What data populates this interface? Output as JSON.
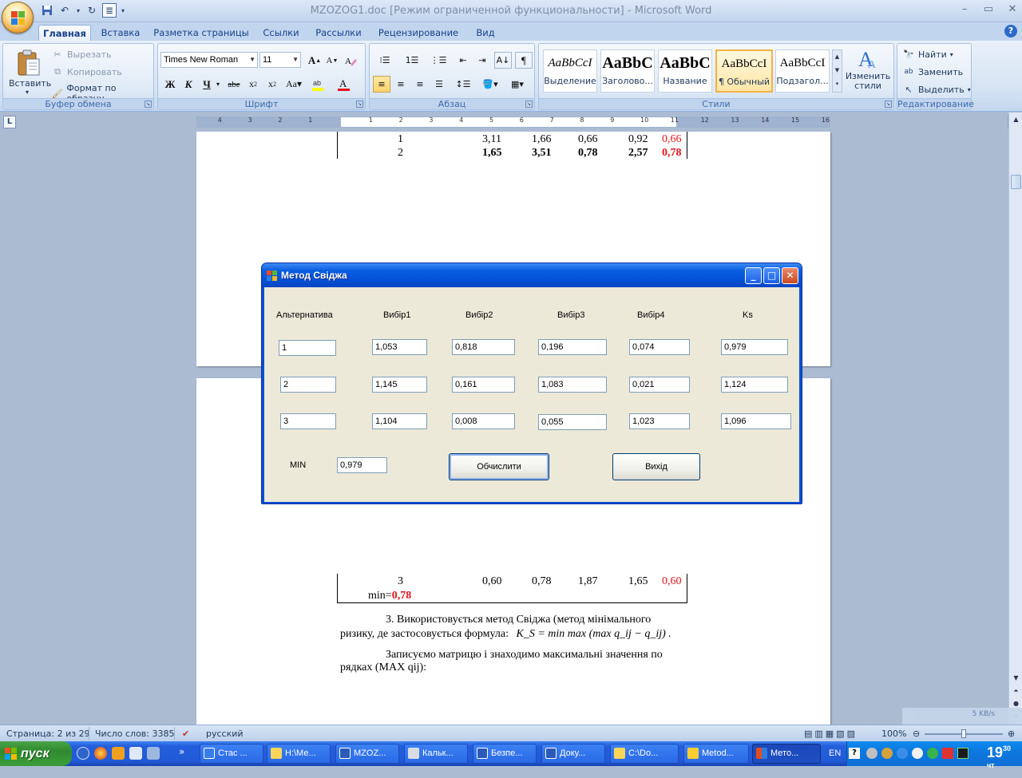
{
  "window": {
    "title": "MZOZOG1.doc [Режим ограниченной функциональности] - Microsoft Word"
  },
  "ribbon": {
    "tabs": [
      {
        "label": "Главная"
      },
      {
        "label": "Вставка"
      },
      {
        "label": "Разметка страницы"
      },
      {
        "label": "Ссылки"
      },
      {
        "label": "Рассылки"
      },
      {
        "label": "Рецензирование"
      },
      {
        "label": "Вид"
      }
    ],
    "clipboard": {
      "group": "Буфер обмена",
      "paste": "Вставить",
      "cut": "Вырезать",
      "copy": "Копировать",
      "format_painter": "Формат по образцу"
    },
    "font": {
      "group": "Шрифт",
      "font_name": "Times New Roman",
      "font_size": "11"
    },
    "paragraph": {
      "group": "Абзац"
    },
    "styles": {
      "group": "Стили",
      "items": [
        {
          "sample": "AaBbCcI",
          "name": "Выделение"
        },
        {
          "sample": "AaBbC",
          "name": "Заголово..."
        },
        {
          "sample": "AaBbC",
          "name": "Название"
        },
        {
          "sample": "AaBbCcI",
          "name": "¶ Обычный"
        },
        {
          "sample": "AaBbCcI",
          "name": "Подзагол..."
        }
      ],
      "change_styles": "Изменить стили"
    },
    "editing": {
      "group": "Редактирование",
      "find": "Найти",
      "replace": "Заменить",
      "select": "Выделить"
    }
  },
  "ruler": {
    "labels": [
      "4",
      "3",
      "2",
      "1",
      "1",
      "2",
      "3",
      "4",
      "5",
      "6",
      "7",
      "8",
      "9",
      "10",
      "11",
      "12",
      "13",
      "14",
      "15",
      "16"
    ]
  },
  "document": {
    "top_table": [
      [
        "1",
        "3,11",
        "1,66",
        "0,66",
        "0,92",
        "0,66"
      ],
      [
        "2",
        "1,65",
        "3,51",
        "0,78",
        "2,57",
        "0,78"
      ]
    ],
    "bottom_table_row": [
      "3",
      "0,60",
      "0,78",
      "1,87",
      "1,65",
      "0,60"
    ],
    "min_label": "min=",
    "min_value": "0,78",
    "para1_line1": "3. Використовується метод Свіджа (метод мінімального",
    "para1_line2": "ризику, де застосовується формула:",
    "formula": "K_S = min max (max q_ij − q_ij) .",
    "para2_line1": "Записуємо матрицю і знаходимо максимальні значення по",
    "para2_line2": "рядках (MAX qij):"
  },
  "dialog": {
    "title": "Метод Свіджа",
    "headers": [
      "Альтернатива",
      "Вибір1",
      "Вибір2",
      "Вибір3",
      "Вибір4",
      "Ks"
    ],
    "rows": [
      [
        "1",
        "1,053",
        "0,818",
        "0,196",
        "0,074",
        "0,979"
      ],
      [
        "2",
        "1,145",
        "0,161",
        "1,083",
        "0,021",
        "1,124"
      ],
      [
        "3",
        "1,104",
        "0,008",
        "0,055",
        "1,023",
        "1,096"
      ]
    ],
    "min_label": "MIN",
    "min_value": "0,979",
    "calc_button": "Обчислити",
    "exit_button": "Вихід"
  },
  "statusbar": {
    "page": "Страница: 2 из 29",
    "words": "Число слов: 3385",
    "language": "русский",
    "zoom": "100%",
    "net_speed": "5 KB/s"
  },
  "taskbar": {
    "start": "пуск",
    "tasks": [
      {
        "label": "Стас ..."
      },
      {
        "label": "H:\\Ме..."
      },
      {
        "label": "MZOZ..."
      },
      {
        "label": "Кальк..."
      },
      {
        "label": "Безпе..."
      },
      {
        "label": "Доку..."
      },
      {
        "label": "C:\\Do..."
      },
      {
        "label": "Metod..."
      },
      {
        "label": "Мето..."
      }
    ],
    "lang": "EN",
    "clock_hours": "19",
    "clock_minutes": "30",
    "clock_day": "чт"
  },
  "colors": {
    "accent_red": "#e3141b",
    "xp_blue": "#0a4fd4",
    "ribbon_blue": "#c2d5ee"
  }
}
